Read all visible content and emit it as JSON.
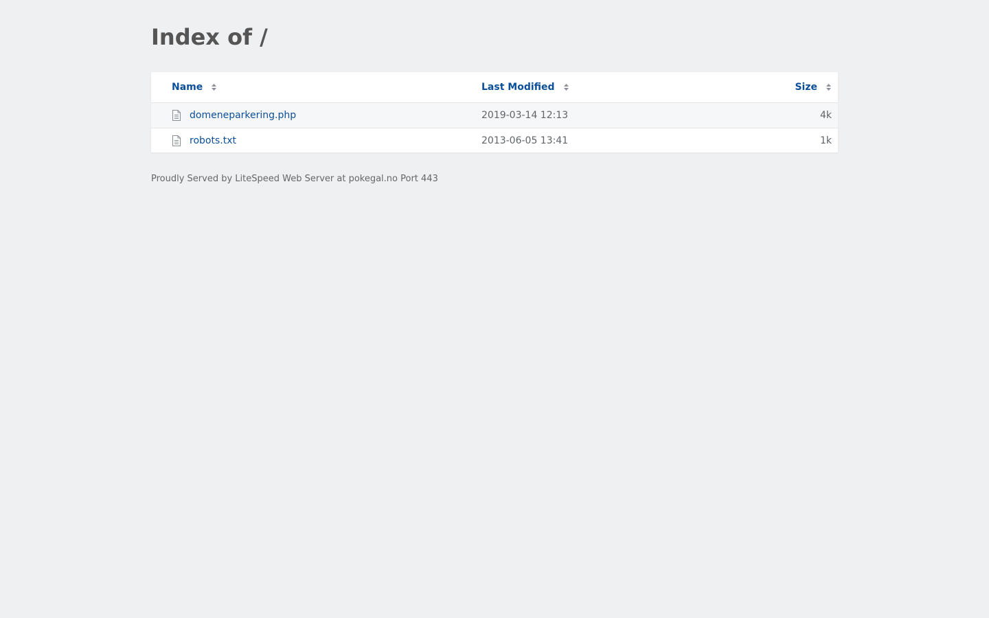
{
  "page": {
    "title": "Index of /"
  },
  "table": {
    "headers": {
      "name": "Name",
      "last_modified": "Last Modified",
      "size": "Size"
    },
    "rows": [
      {
        "name": "domeneparkering.php",
        "modified": "2019-03-14 12:13",
        "size": "4k",
        "icon": "file-icon"
      },
      {
        "name": "robots.txt",
        "modified": "2013-06-05 13:41",
        "size": "1k",
        "icon": "file-icon"
      }
    ]
  },
  "footer": {
    "text": "Proudly Served by LiteSpeed Web Server at pokegal.no Port 443"
  },
  "colors": {
    "link": "#0b4f9a",
    "background": "#eef0f2",
    "title": "#555555"
  }
}
